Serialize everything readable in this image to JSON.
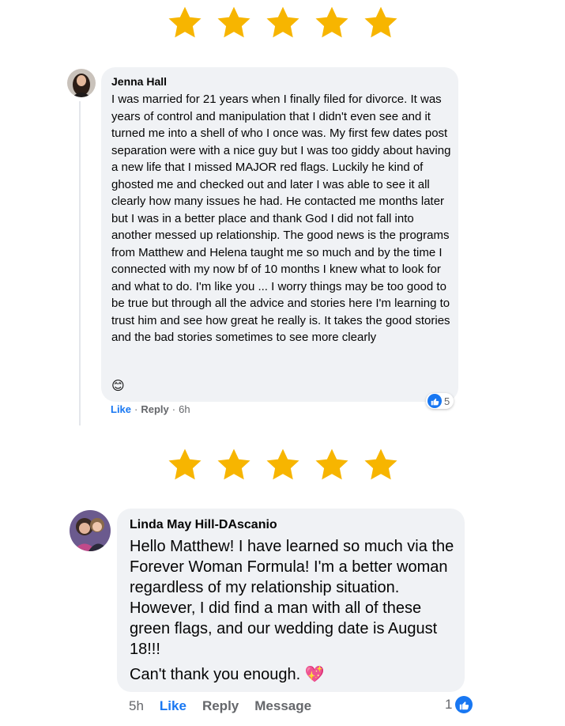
{
  "rating_top": {
    "stars": 5,
    "star_color": "#f7b500"
  },
  "comment1": {
    "author": "Jenna Hall",
    "text": "I was married for 21 years when I finally filed for divorce. It was years of control and manipulation that I didn't even see and it turned me into a shell of who I once was. My first few dates post separation were with a nice guy but I was too giddy about having a new life that I missed MAJOR red flags. Luckily he kind of ghosted me and checked out and later I was able to see it all clearly how many issues he had. He contacted me months later but I was in a better place and thank God I did not fall into another messed up relationship. The good news is the programs from Matthew and Helena taught me so much and by the time I connected with my now bf of 10 months I knew what to look for and what to do. I'm like you ... I worry things may be too good to be true but through all the advice and stories here I'm learning to trust him and see how great he really is. It takes the good stories and the bad stories sometimes to see more clearly",
    "emoji": "😊",
    "reaction_count": "5",
    "like_label": "Like",
    "reply_label": "Reply",
    "time": "6h",
    "separator": "·"
  },
  "rating_bottom": {
    "stars": 5,
    "star_color": "#f7b500"
  },
  "comment2": {
    "author": "Linda May Hill-DAscanio",
    "paragraph1": "Hello Matthew! I have learned so much via the Forever Woman Formula! I'm a better woman regardless of my relationship situation. However, I did find a man with all of these green flags, and our wedding date is August 18!!!",
    "paragraph2": "Can't thank you enough.",
    "emoji": "💖",
    "time": "5h",
    "like_label": "Like",
    "reply_label": "Reply",
    "message_label": "Message",
    "reaction_count": "1"
  },
  "colors": {
    "bubble": "#f0f2f5",
    "link_blue": "#1877f2",
    "meta_gray": "#65676b"
  }
}
